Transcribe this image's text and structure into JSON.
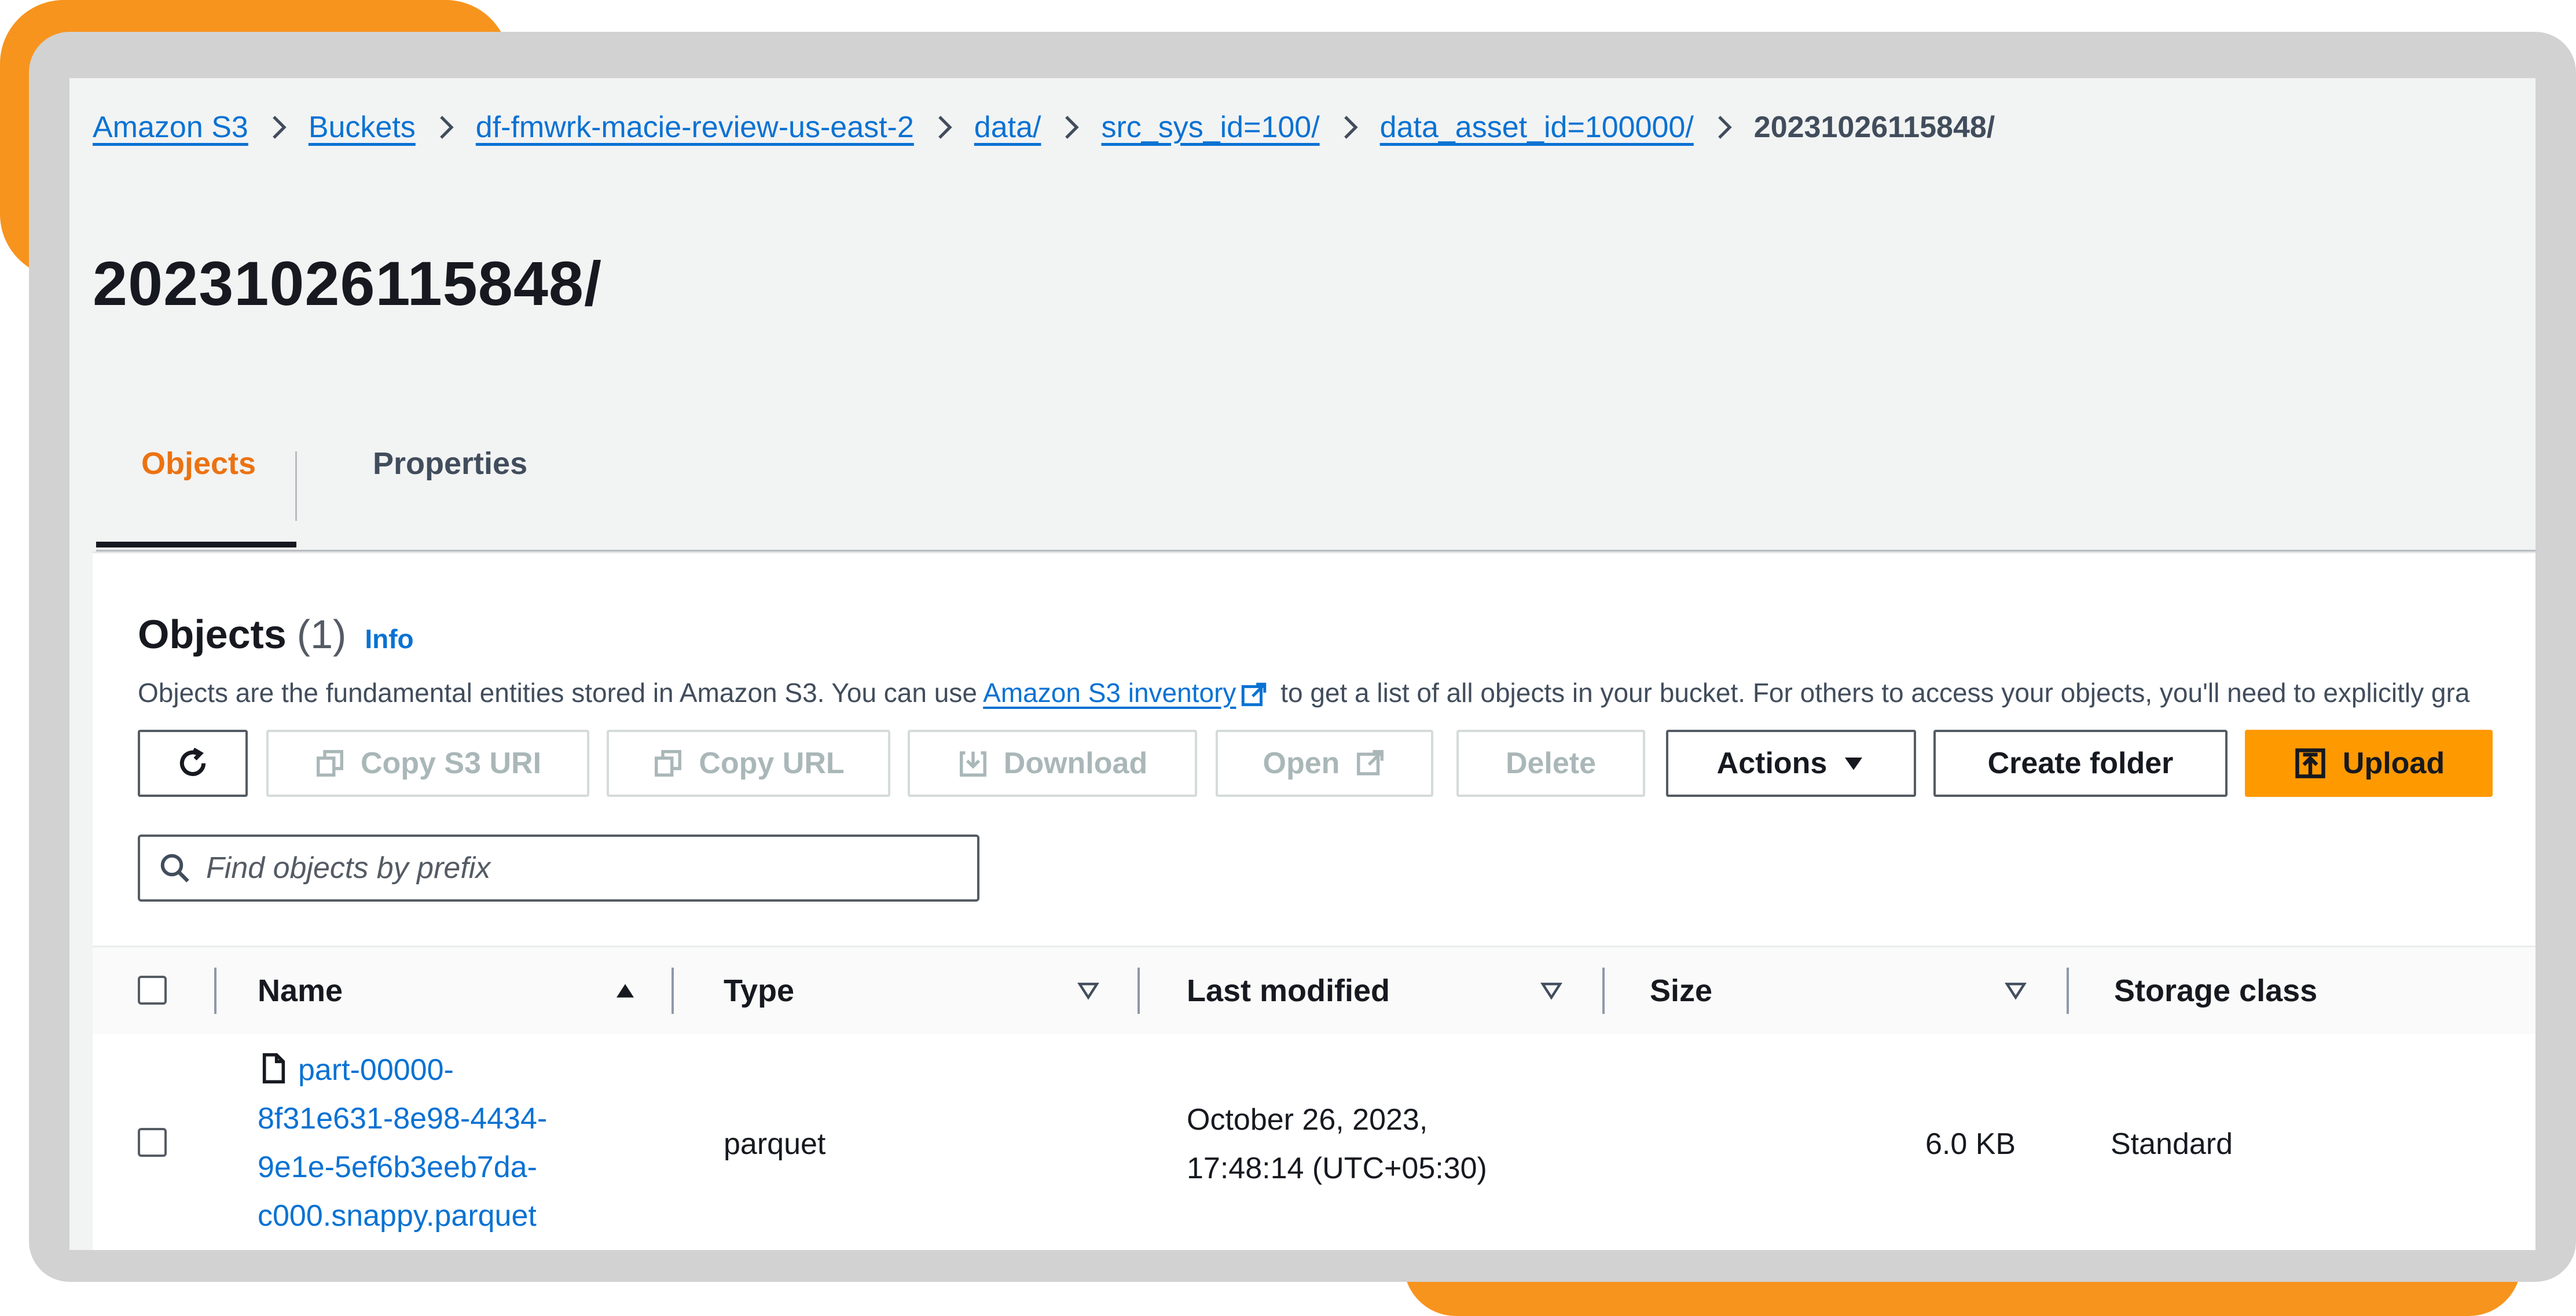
{
  "breadcrumb": {
    "items": [
      "Amazon S3",
      "Buckets",
      "df-fmwrk-macie-review-us-east-2",
      "data/",
      "src_sys_id=100/",
      "data_asset_id=100000/"
    ],
    "current": "20231026115848/"
  },
  "page_title": "20231026115848/",
  "tabs": [
    "Objects",
    "Properties"
  ],
  "active_tab": "Objects",
  "objects_panel": {
    "title": "Objects",
    "count": "(1)",
    "info_label": "Info",
    "desc_before": "Objects are the fundamental entities stored in Amazon S3. You can use ",
    "desc_link": "Amazon S3 inventory",
    "desc_after": " to get a list of all objects in your bucket. For others to access your objects, you'll need to explicitly gra"
  },
  "toolbar": {
    "refresh_icon": "refresh-icon",
    "copy_s3_uri": "Copy S3 URI",
    "copy_url": "Copy URL",
    "download": "Download",
    "open": "Open",
    "delete": "Delete",
    "actions": "Actions",
    "create_folder": "Create folder",
    "upload": "Upload"
  },
  "search": {
    "placeholder": "Find objects by prefix",
    "value": ""
  },
  "table": {
    "columns": [
      "Name",
      "Type",
      "Last modified",
      "Size",
      "Storage class"
    ],
    "rows": [
      {
        "name_lines": [
          "part-00000-",
          "8f31e631-8e98-4434-",
          "9e1e-5ef6b3eeb7da-",
          "c000.snappy.parquet"
        ],
        "type": "parquet",
        "last_modified_lines": [
          "October 26, 2023,",
          "17:48:14 (UTC+05:30)"
        ],
        "size": "6.0 KB",
        "storage_class": "Standard"
      }
    ]
  },
  "colors": {
    "accent": "#ec7211",
    "link": "#0972d3",
    "primary_button": "#ff9900",
    "frame_orange": "#f7941d"
  }
}
